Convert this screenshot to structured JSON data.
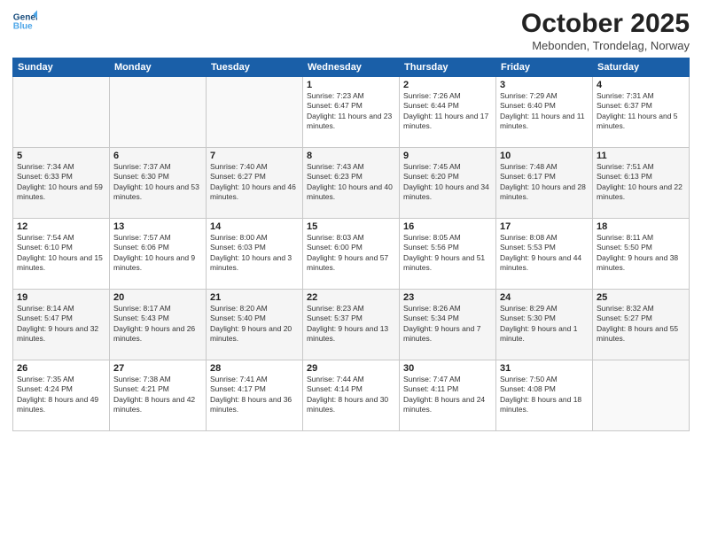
{
  "header": {
    "logo_line1": "General",
    "logo_line2": "Blue",
    "month": "October 2025",
    "location": "Mebonden, Trondelag, Norway"
  },
  "days_of_week": [
    "Sunday",
    "Monday",
    "Tuesday",
    "Wednesday",
    "Thursday",
    "Friday",
    "Saturday"
  ],
  "weeks": [
    [
      {
        "day": "",
        "sunrise": "",
        "sunset": "",
        "daylight": ""
      },
      {
        "day": "",
        "sunrise": "",
        "sunset": "",
        "daylight": ""
      },
      {
        "day": "",
        "sunrise": "",
        "sunset": "",
        "daylight": ""
      },
      {
        "day": "1",
        "sunrise": "Sunrise: 7:23 AM",
        "sunset": "Sunset: 6:47 PM",
        "daylight": "Daylight: 11 hours and 23 minutes."
      },
      {
        "day": "2",
        "sunrise": "Sunrise: 7:26 AM",
        "sunset": "Sunset: 6:44 PM",
        "daylight": "Daylight: 11 hours and 17 minutes."
      },
      {
        "day": "3",
        "sunrise": "Sunrise: 7:29 AM",
        "sunset": "Sunset: 6:40 PM",
        "daylight": "Daylight: 11 hours and 11 minutes."
      },
      {
        "day": "4",
        "sunrise": "Sunrise: 7:31 AM",
        "sunset": "Sunset: 6:37 PM",
        "daylight": "Daylight: 11 hours and 5 minutes."
      }
    ],
    [
      {
        "day": "5",
        "sunrise": "Sunrise: 7:34 AM",
        "sunset": "Sunset: 6:33 PM",
        "daylight": "Daylight: 10 hours and 59 minutes."
      },
      {
        "day": "6",
        "sunrise": "Sunrise: 7:37 AM",
        "sunset": "Sunset: 6:30 PM",
        "daylight": "Daylight: 10 hours and 53 minutes."
      },
      {
        "day": "7",
        "sunrise": "Sunrise: 7:40 AM",
        "sunset": "Sunset: 6:27 PM",
        "daylight": "Daylight: 10 hours and 46 minutes."
      },
      {
        "day": "8",
        "sunrise": "Sunrise: 7:43 AM",
        "sunset": "Sunset: 6:23 PM",
        "daylight": "Daylight: 10 hours and 40 minutes."
      },
      {
        "day": "9",
        "sunrise": "Sunrise: 7:45 AM",
        "sunset": "Sunset: 6:20 PM",
        "daylight": "Daylight: 10 hours and 34 minutes."
      },
      {
        "day": "10",
        "sunrise": "Sunrise: 7:48 AM",
        "sunset": "Sunset: 6:17 PM",
        "daylight": "Daylight: 10 hours and 28 minutes."
      },
      {
        "day": "11",
        "sunrise": "Sunrise: 7:51 AM",
        "sunset": "Sunset: 6:13 PM",
        "daylight": "Daylight: 10 hours and 22 minutes."
      }
    ],
    [
      {
        "day": "12",
        "sunrise": "Sunrise: 7:54 AM",
        "sunset": "Sunset: 6:10 PM",
        "daylight": "Daylight: 10 hours and 15 minutes."
      },
      {
        "day": "13",
        "sunrise": "Sunrise: 7:57 AM",
        "sunset": "Sunset: 6:06 PM",
        "daylight": "Daylight: 10 hours and 9 minutes."
      },
      {
        "day": "14",
        "sunrise": "Sunrise: 8:00 AM",
        "sunset": "Sunset: 6:03 PM",
        "daylight": "Daylight: 10 hours and 3 minutes."
      },
      {
        "day": "15",
        "sunrise": "Sunrise: 8:03 AM",
        "sunset": "Sunset: 6:00 PM",
        "daylight": "Daylight: 9 hours and 57 minutes."
      },
      {
        "day": "16",
        "sunrise": "Sunrise: 8:05 AM",
        "sunset": "Sunset: 5:56 PM",
        "daylight": "Daylight: 9 hours and 51 minutes."
      },
      {
        "day": "17",
        "sunrise": "Sunrise: 8:08 AM",
        "sunset": "Sunset: 5:53 PM",
        "daylight": "Daylight: 9 hours and 44 minutes."
      },
      {
        "day": "18",
        "sunrise": "Sunrise: 8:11 AM",
        "sunset": "Sunset: 5:50 PM",
        "daylight": "Daylight: 9 hours and 38 minutes."
      }
    ],
    [
      {
        "day": "19",
        "sunrise": "Sunrise: 8:14 AM",
        "sunset": "Sunset: 5:47 PM",
        "daylight": "Daylight: 9 hours and 32 minutes."
      },
      {
        "day": "20",
        "sunrise": "Sunrise: 8:17 AM",
        "sunset": "Sunset: 5:43 PM",
        "daylight": "Daylight: 9 hours and 26 minutes."
      },
      {
        "day": "21",
        "sunrise": "Sunrise: 8:20 AM",
        "sunset": "Sunset: 5:40 PM",
        "daylight": "Daylight: 9 hours and 20 minutes."
      },
      {
        "day": "22",
        "sunrise": "Sunrise: 8:23 AM",
        "sunset": "Sunset: 5:37 PM",
        "daylight": "Daylight: 9 hours and 13 minutes."
      },
      {
        "day": "23",
        "sunrise": "Sunrise: 8:26 AM",
        "sunset": "Sunset: 5:34 PM",
        "daylight": "Daylight: 9 hours and 7 minutes."
      },
      {
        "day": "24",
        "sunrise": "Sunrise: 8:29 AM",
        "sunset": "Sunset: 5:30 PM",
        "daylight": "Daylight: 9 hours and 1 minute."
      },
      {
        "day": "25",
        "sunrise": "Sunrise: 8:32 AM",
        "sunset": "Sunset: 5:27 PM",
        "daylight": "Daylight: 8 hours and 55 minutes."
      }
    ],
    [
      {
        "day": "26",
        "sunrise": "Sunrise: 7:35 AM",
        "sunset": "Sunset: 4:24 PM",
        "daylight": "Daylight: 8 hours and 49 minutes."
      },
      {
        "day": "27",
        "sunrise": "Sunrise: 7:38 AM",
        "sunset": "Sunset: 4:21 PM",
        "daylight": "Daylight: 8 hours and 42 minutes."
      },
      {
        "day": "28",
        "sunrise": "Sunrise: 7:41 AM",
        "sunset": "Sunset: 4:17 PM",
        "daylight": "Daylight: 8 hours and 36 minutes."
      },
      {
        "day": "29",
        "sunrise": "Sunrise: 7:44 AM",
        "sunset": "Sunset: 4:14 PM",
        "daylight": "Daylight: 8 hours and 30 minutes."
      },
      {
        "day": "30",
        "sunrise": "Sunrise: 7:47 AM",
        "sunset": "Sunset: 4:11 PM",
        "daylight": "Daylight: 8 hours and 24 minutes."
      },
      {
        "day": "31",
        "sunrise": "Sunrise: 7:50 AM",
        "sunset": "Sunset: 4:08 PM",
        "daylight": "Daylight: 8 hours and 18 minutes."
      },
      {
        "day": "",
        "sunrise": "",
        "sunset": "",
        "daylight": ""
      }
    ]
  ]
}
